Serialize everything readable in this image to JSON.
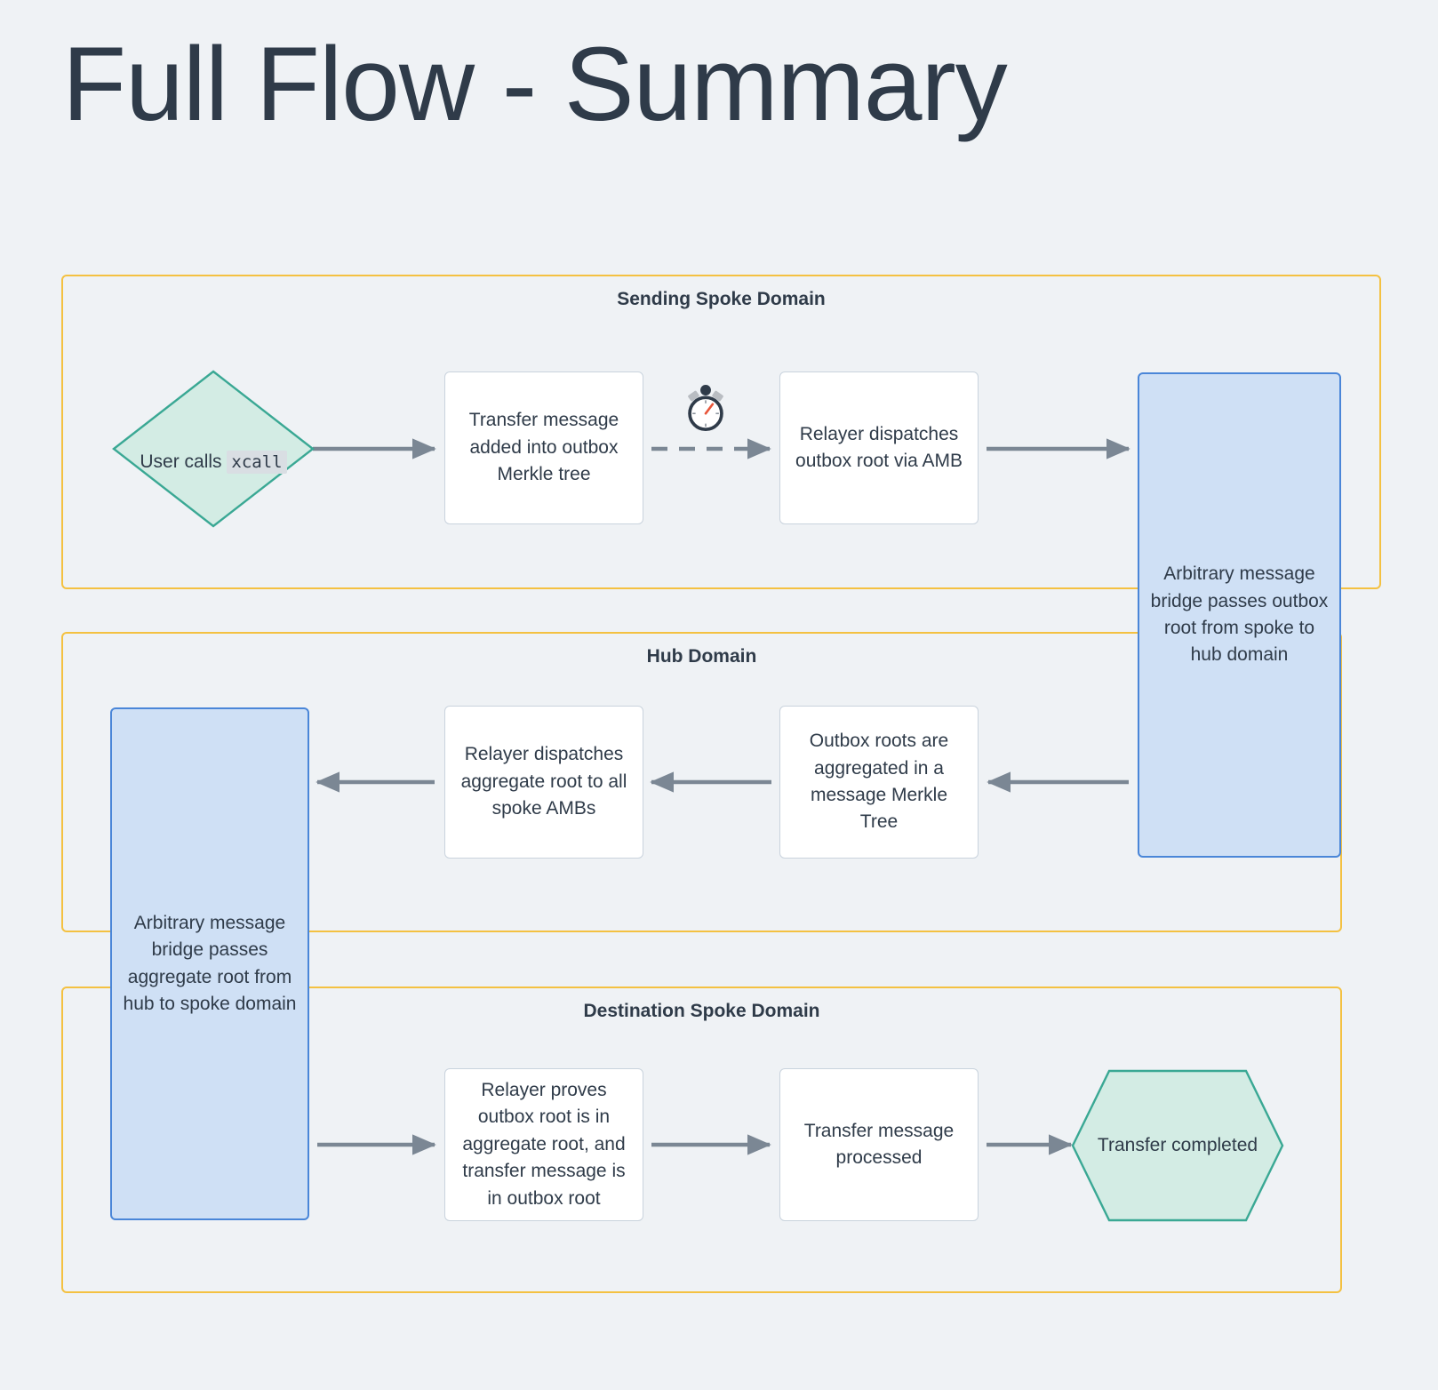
{
  "title": "Full Flow - Summary",
  "theme": {
    "background": "#eff2f5",
    "subgraph_border": "#f4c141",
    "text": "#2f3b49",
    "node_border": "#c9d3dd",
    "node_fill": "#ffffff",
    "amb_fill": "#cfe0f5",
    "amb_border": "#4a86d8",
    "accent_teal": "#3aa894",
    "accent_teal_fill": "#d3ece4",
    "edge": "#7b8794"
  },
  "subgraphs": [
    {
      "id": "sending",
      "title": "Sending Spoke Domain"
    },
    {
      "id": "hub",
      "title": "Hub Domain"
    },
    {
      "id": "destination",
      "title": "Destination Spoke Domain"
    }
  ],
  "nodes": {
    "user_call": {
      "prefix": "User calls ",
      "code": "xcall",
      "shape": "diamond"
    },
    "outbox_tree": {
      "label": "Transfer message\nadded into outbox\nMerkle tree",
      "shape": "rect"
    },
    "relayer_dispatch_outbox": {
      "label": "Relayer dispatches\noutbox root via AMB",
      "shape": "rect"
    },
    "amb_spoke_to_hub": {
      "label": "Arbitrary message\nbridge passes outbox\nroot from spoke to\nhub domain",
      "shape": "amb"
    },
    "aggregate_tree": {
      "label": "Outbox roots are\naggregated in a\nmessage Merkle Tree",
      "shape": "rect"
    },
    "relayer_dispatch_aggregate": {
      "label": "Relayer dispatches\naggregate root to all\nspoke AMBs",
      "shape": "rect"
    },
    "amb_hub_to_spoke": {
      "label": "Arbitrary message\nbridge passes\naggregate root from\nhub to spoke domain",
      "shape": "amb"
    },
    "relayer_proves": {
      "label": "Relayer proves\noutbox root is in\naggregate root, and\ntransfer message is\nin outbox root",
      "shape": "rect"
    },
    "message_processed": {
      "label": "Transfer message\nprocessed",
      "shape": "rect"
    },
    "transfer_completed": {
      "label": "Transfer completed",
      "shape": "hexagon"
    }
  },
  "icons": {
    "delay": "stopwatch-icon"
  }
}
